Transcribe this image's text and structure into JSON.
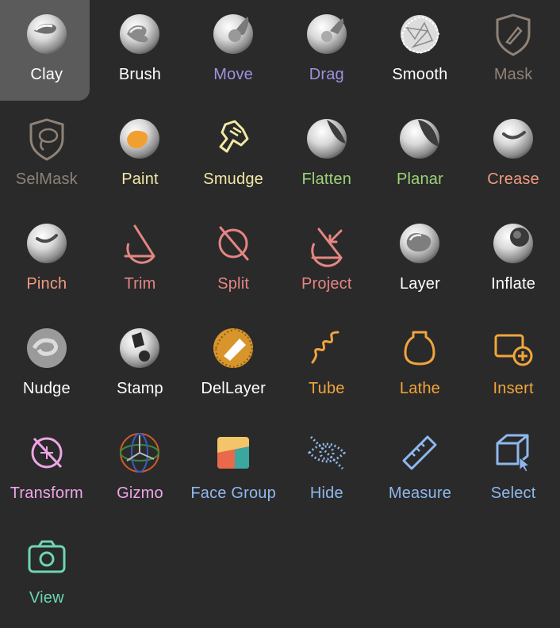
{
  "tools": [
    {
      "label": "Clay",
      "color": "#ffffff",
      "icon": "clay-icon"
    },
    {
      "label": "Brush",
      "color": "#ffffff",
      "icon": "brush-icon"
    },
    {
      "label": "Move",
      "color": "#9d93e0",
      "icon": "move-icon"
    },
    {
      "label": "Drag",
      "color": "#9d93e0",
      "icon": "drag-icon"
    },
    {
      "label": "Smooth",
      "color": "#ffffff",
      "icon": "smooth-icon"
    },
    {
      "label": "Mask",
      "color": "#8f8277",
      "icon": "mask-icon"
    },
    {
      "label": "SelMask",
      "color": "#8f8277",
      "icon": "selmask-icon"
    },
    {
      "label": "Paint",
      "color": "#f3e9a6",
      "icon": "paint-icon"
    },
    {
      "label": "Smudge",
      "color": "#f3e9a6",
      "icon": "smudge-icon"
    },
    {
      "label": "Flatten",
      "color": "#9bd47a",
      "icon": "flatten-icon"
    },
    {
      "label": "Planar",
      "color": "#9bd47a",
      "icon": "planar-icon"
    },
    {
      "label": "Crease",
      "color": "#f29a80",
      "icon": "crease-icon"
    },
    {
      "label": "Pinch",
      "color": "#f29a80",
      "icon": "pinch-icon"
    },
    {
      "label": "Trim",
      "color": "#e58683",
      "icon": "trim-icon"
    },
    {
      "label": "Split",
      "color": "#e58683",
      "icon": "split-icon"
    },
    {
      "label": "Project",
      "color": "#e58683",
      "icon": "project-icon"
    },
    {
      "label": "Layer",
      "color": "#ffffff",
      "icon": "layer-icon"
    },
    {
      "label": "Inflate",
      "color": "#ffffff",
      "icon": "inflate-icon"
    },
    {
      "label": "Nudge",
      "color": "#ffffff",
      "icon": "nudge-icon"
    },
    {
      "label": "Stamp",
      "color": "#ffffff",
      "icon": "stamp-icon"
    },
    {
      "label": "DelLayer",
      "color": "#ffffff",
      "icon": "dellayer-icon"
    },
    {
      "label": "Tube",
      "color": "#f2a53c",
      "icon": "tube-icon"
    },
    {
      "label": "Lathe",
      "color": "#f2a53c",
      "icon": "lathe-icon"
    },
    {
      "label": "Insert",
      "color": "#f2a53c",
      "icon": "insert-icon"
    },
    {
      "label": "Transform",
      "color": "#eea6e7",
      "icon": "transform-icon"
    },
    {
      "label": "Gizmo",
      "color": "#eea6e7",
      "icon": "gizmo-icon"
    },
    {
      "label": "Face Group",
      "color": "#8fb8ee",
      "icon": "face-group-icon"
    },
    {
      "label": "Hide",
      "color": "#8fb8ee",
      "icon": "hide-icon"
    },
    {
      "label": "Measure",
      "color": "#8fb8ee",
      "icon": "measure-icon"
    },
    {
      "label": "Select",
      "color": "#8fb8ee",
      "icon": "select-icon"
    },
    {
      "label": "View",
      "color": "#6dd6b0",
      "icon": "view-icon"
    }
  ],
  "selected": "Clay"
}
